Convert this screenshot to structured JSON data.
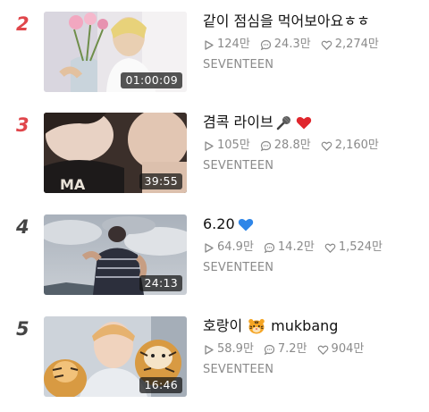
{
  "colors": {
    "rank_top": "#e0464b",
    "rank_normal": "#444444",
    "meta": "#8a8a8a",
    "title": "#111111"
  },
  "videos": [
    {
      "rank": "2",
      "title": "같이 점심을 먹어보아요ㅎㅎ",
      "title_emoji": [],
      "duration": "01:00:09",
      "plays": "124만",
      "comments": "24.3만",
      "likes": "2,274만",
      "channel": "SEVENTEEN",
      "thumbnail": "person-holding-flowers"
    },
    {
      "rank": "3",
      "title": "겸콕 라이브",
      "title_emoji": [
        "microphone-emoji",
        "red-heart-emoji"
      ],
      "duration": "39:55",
      "plays": "105만",
      "comments": "28.8만",
      "likes": "2,160만",
      "channel": "SEVENTEEN",
      "thumbnail": "selfie-close-up"
    },
    {
      "rank": "4",
      "title": "6.20",
      "title_emoji": [
        "blue-heart-emoji"
      ],
      "duration": "24:13",
      "plays": "64.9만",
      "comments": "14.2만",
      "likes": "1,524만",
      "channel": "SEVENTEEN",
      "thumbnail": "person-against-cloudy-sky"
    },
    {
      "rank": "5",
      "title": "호랑이",
      "title_suffix": "mukbang",
      "title_emoji": [
        "tiger-emoji"
      ],
      "duration": "16:46",
      "plays": "58.9만",
      "comments": "7.2만",
      "likes": "904만",
      "channel": "SEVENTEEN",
      "thumbnail": "person-with-tiger-plushies"
    }
  ]
}
